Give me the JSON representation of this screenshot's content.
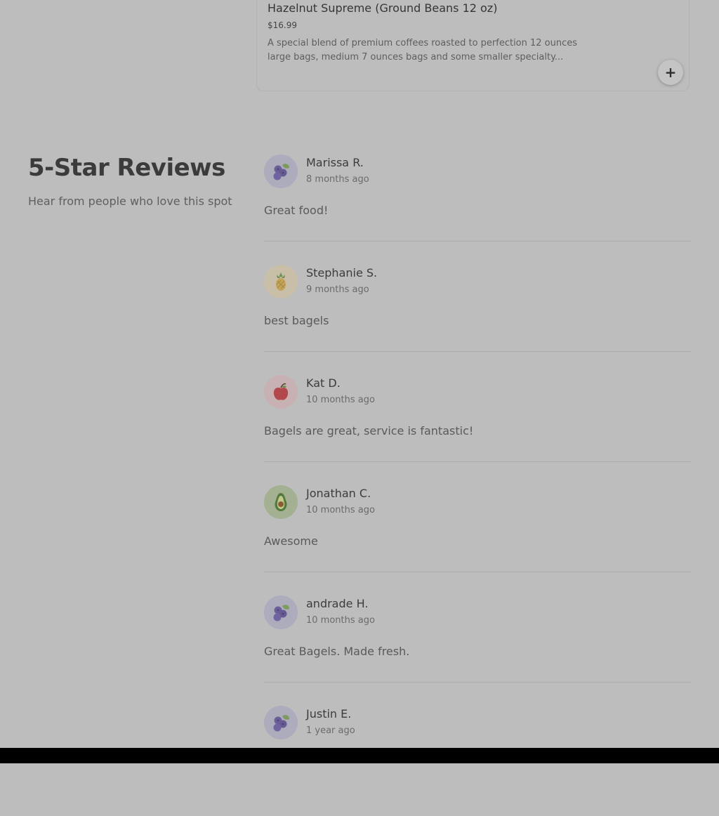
{
  "product": {
    "name": "Hazelnut Supreme (Ground Beans 12 oz)",
    "price": "$16.99",
    "description": "A special blend of premium coffees roasted to perfection 12 ounces large bags, medium 7 ounces bags and some smaller specialty...",
    "add_icon": "+"
  },
  "reviews_section": {
    "title": "5-Star Reviews",
    "subtitle": "Hear from people who love this spot"
  },
  "reviews": [
    {
      "name": "Marissa R.",
      "time": "8 months ago",
      "text": "Great food!",
      "avatar": "blueberry-icon"
    },
    {
      "name": "Stephanie S.",
      "time": "9 months ago",
      "text": "best bagels",
      "avatar": "pineapple-icon"
    },
    {
      "name": "Kat D.",
      "time": "10 months ago",
      "text": "Bagels are great, service is fantastic!",
      "avatar": "apple-icon"
    },
    {
      "name": "Jonathan C.",
      "time": "10 months ago",
      "text": "Awesome",
      "avatar": "avocado-icon"
    },
    {
      "name": "andrade H.",
      "time": "10 months ago",
      "text": "Great Bagels. Made fresh.",
      "avatar": "blueberry-icon"
    },
    {
      "name": "Justin E.",
      "time": "1 year ago",
      "text": "",
      "avatar": "blueberry-icon"
    }
  ],
  "colors": {
    "overlay": "#bdbdbd",
    "blueberry_bg": "#acacbc",
    "pineapple_bg": "#c9bfa9",
    "apple_bg": "#c8b1b3",
    "avocado_bg": "#a3b091"
  }
}
